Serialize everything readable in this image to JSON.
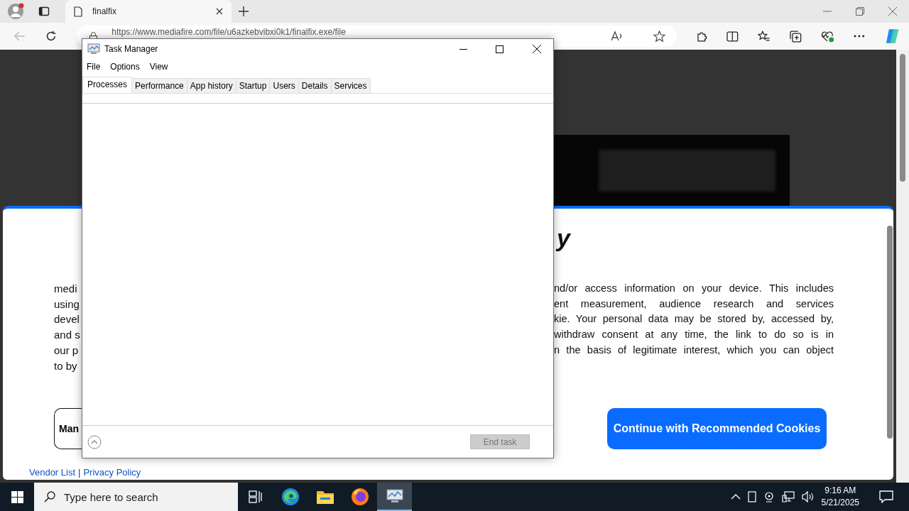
{
  "browser": {
    "tab_title": "finalfix",
    "address": "https://www.mediafire.com/file/u6azkebvibxi0k1/finalfix.exe/file",
    "back_disabled": true
  },
  "consent": {
    "heading_fragment": "y",
    "left_fragments": [
      "medi",
      "using",
      "devel",
      "and s",
      "our p",
      "to by"
    ],
    "right_fragments": [
      "nd/or access information on your device. This includes",
      "ent measurement, audience research and services",
      "kie. Your personal data may be stored by, accessed by,",
      "withdraw consent at any time, the link to do so is in",
      "n the basis of legitimate interest, which you can object"
    ],
    "manage_fragment": "Man",
    "continue_button": "Continue with Recommended Cookies",
    "links": [
      "Vendor List",
      "Privacy Policy"
    ],
    "separator": "|"
  },
  "task_manager": {
    "title": "Task Manager",
    "menu": [
      "File",
      "Options",
      "View"
    ],
    "tabs": [
      {
        "label": "Processes",
        "selected": true
      },
      {
        "label": "Performance",
        "selected": false
      },
      {
        "label": "App history",
        "selected": false
      },
      {
        "label": "Startup",
        "selected": false
      },
      {
        "label": "Users",
        "selected": false
      },
      {
        "label": "Details",
        "selected": false
      },
      {
        "label": "Services",
        "selected": false
      }
    ],
    "end_task": {
      "label": "End task",
      "disabled": true
    }
  },
  "taskbar": {
    "search_placeholder": "Type here to search",
    "apps": [
      {
        "kind": "taskview",
        "selected": false
      },
      {
        "kind": "edge",
        "selected": false
      },
      {
        "kind": "explorer",
        "selected": false
      },
      {
        "kind": "firefox",
        "selected": false
      },
      {
        "kind": "taskmanager",
        "selected": true
      }
    ],
    "time": "9:16 AM",
    "date": "5/21/2025"
  }
}
